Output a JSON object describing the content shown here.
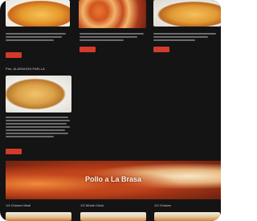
{
  "menu": {
    "featured_item": {
      "title": "Pes. ALARAHON PAELLA",
      "button_label": ""
    },
    "top_cards": [
      {
        "button_label": ""
      },
      {
        "button_label": ""
      },
      {
        "button_label": ""
      }
    ],
    "banner": {
      "title": "Pollo a La Brasa"
    },
    "bottom_cards": [
      {
        "title": "1/4 Chicken Meal"
      },
      {
        "title": "1/2 Whole Chick"
      },
      {
        "title": "1/2 Chicken"
      }
    ]
  },
  "colors": {
    "background": "#141414",
    "button": "#d23b2c",
    "text": "#cfcfcf"
  }
}
